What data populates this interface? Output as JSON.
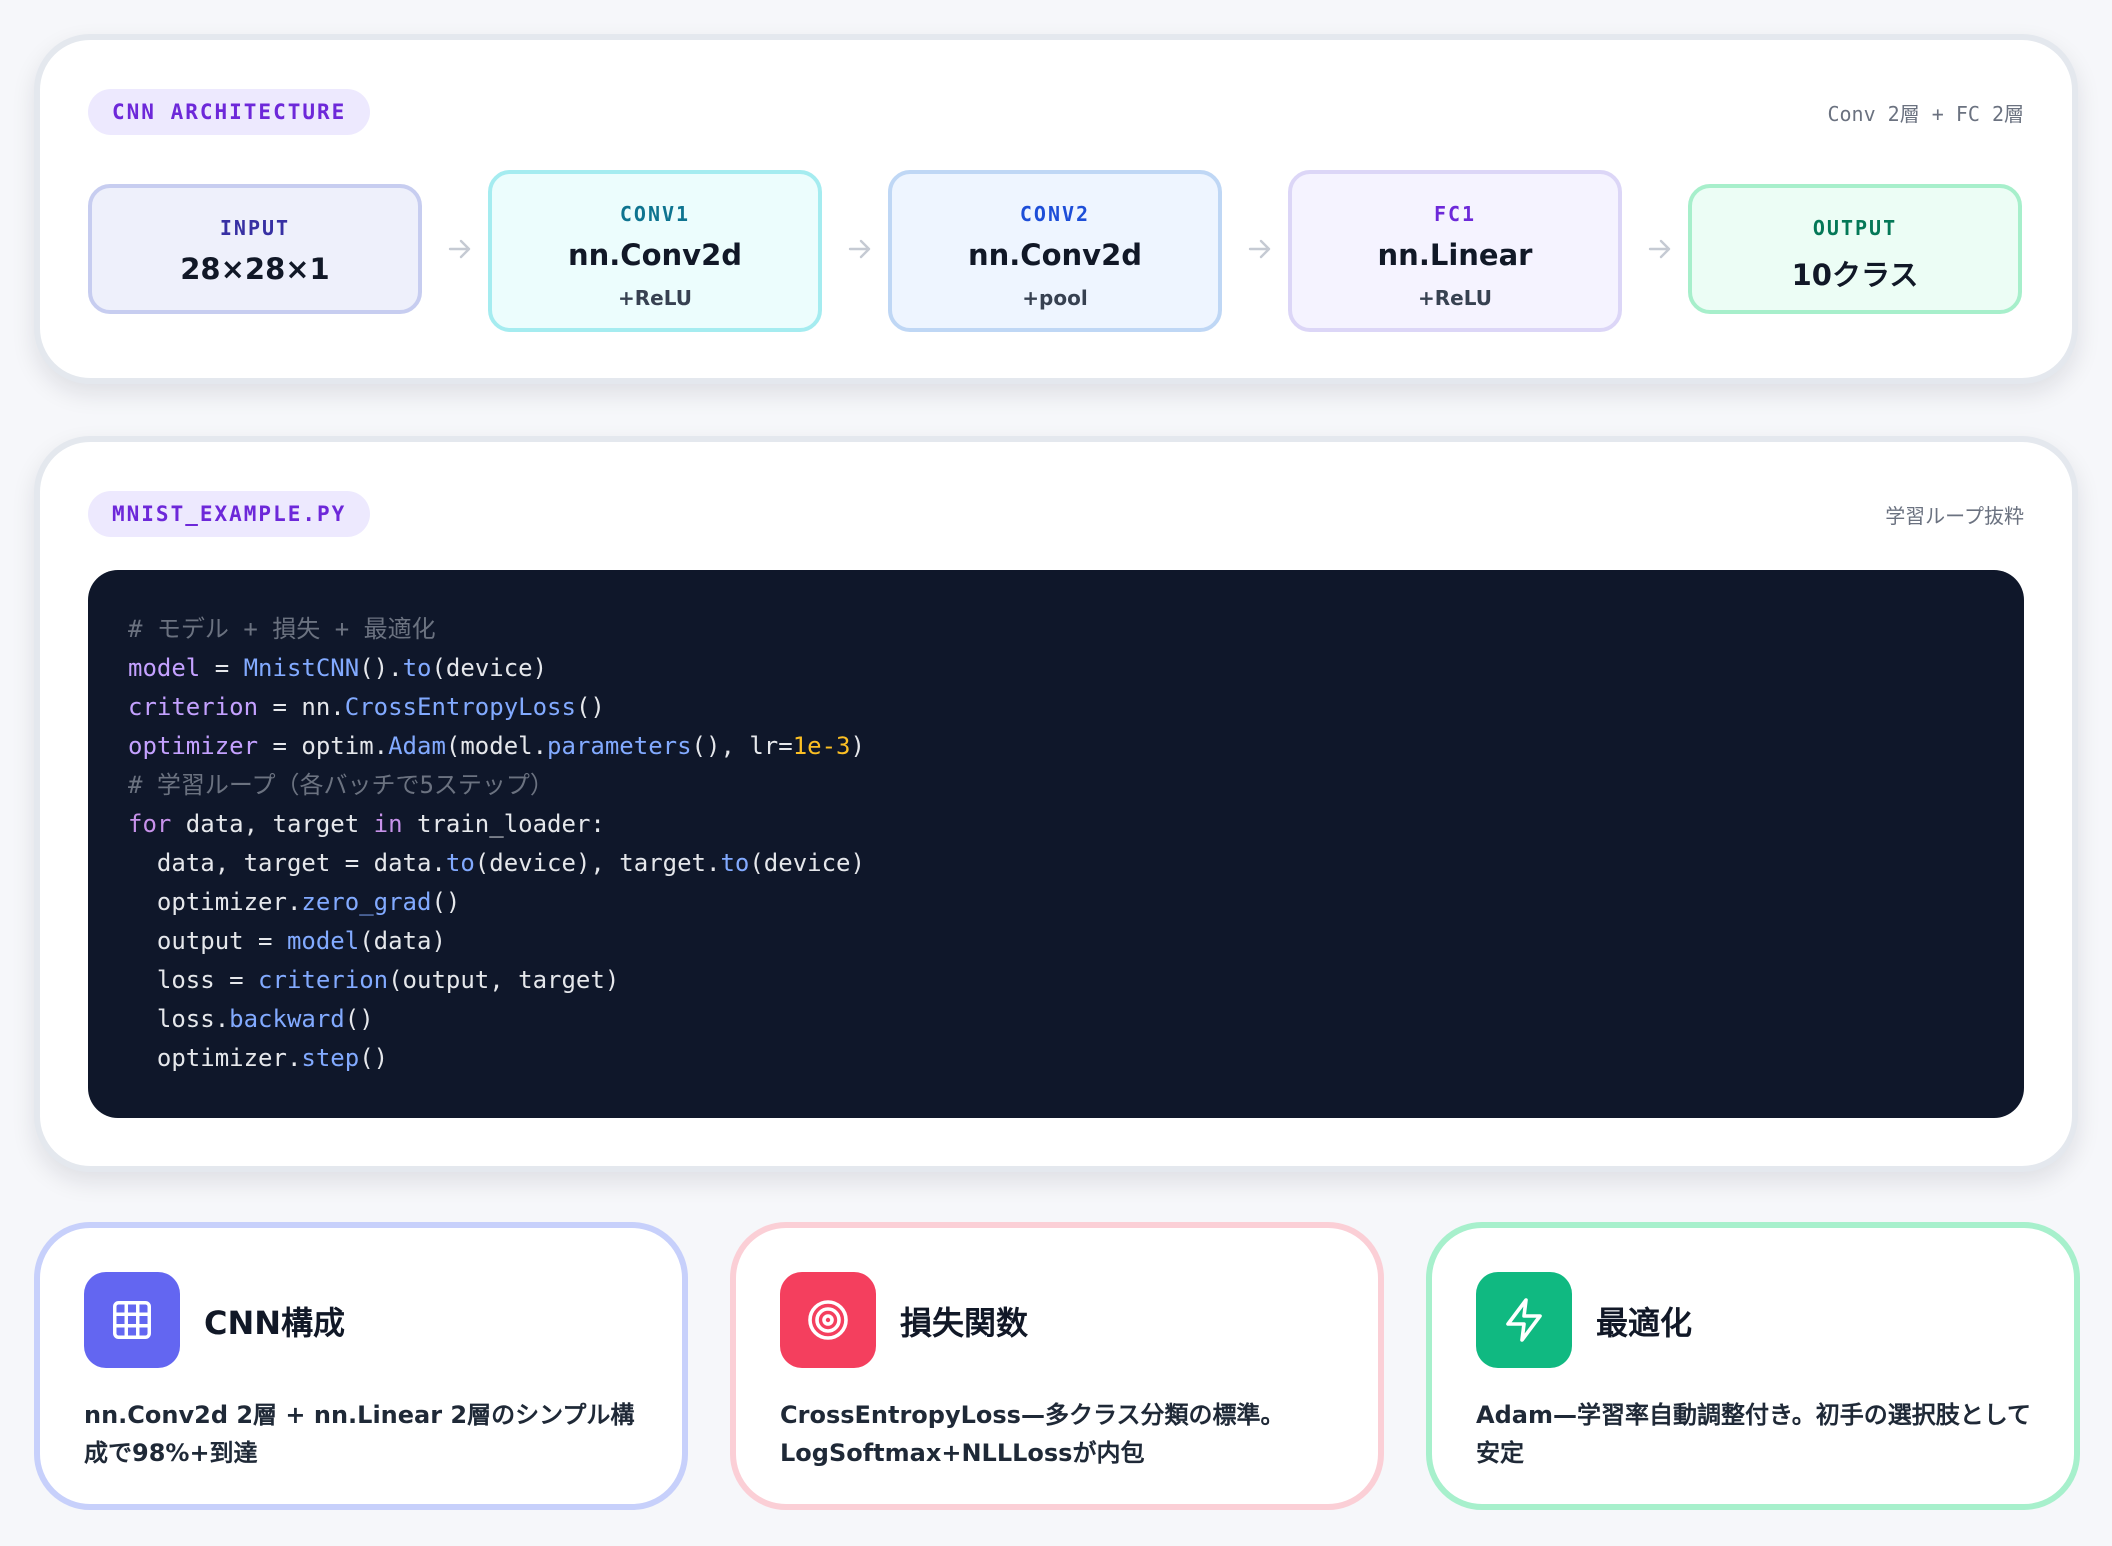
{
  "architecture": {
    "badge": "CNN ARCHITECTURE",
    "summary": "Conv 2層 + FC 2層",
    "stages": [
      {
        "label": "INPUT",
        "main": "28×28×1",
        "sub": ""
      },
      {
        "label": "CONV1",
        "main": "nn.Conv2d",
        "sub": "+ReLU"
      },
      {
        "label": "CONV2",
        "main": "nn.Conv2d",
        "sub": "+pool"
      },
      {
        "label": "FC1",
        "main": "nn.Linear",
        "sub": "+ReLU"
      },
      {
        "label": "OUTPUT",
        "main": "10クラス",
        "sub": ""
      }
    ]
  },
  "code": {
    "badge": "MNIST_EXAMPLE.PY",
    "caption": "学習ループ抜粋",
    "lines": [
      "# モデル + 損失 + 最適化",
      "model = MnistCNN().to(device)",
      "criterion = nn.CrossEntropyLoss()",
      "optimizer = optim.Adam(model.parameters(), lr=1e-3)",
      "# 学習ループ（各バッチで5ステップ）",
      "for data, target in train_loader:",
      "  data, target = data.to(device), target.to(device)",
      "  optimizer.zero_grad()",
      "  output = model(data)",
      "  loss = criterion(output, target)",
      "  loss.backward()",
      "  optimizer.step()"
    ]
  },
  "features": [
    {
      "icon": "grid-icon",
      "title": "CNN構成",
      "desc": "nn.Conv2d 2層 + nn.Linear 2層のシンプル構成で98%+到達"
    },
    {
      "icon": "target-icon",
      "title": "損失関数",
      "desc": "CrossEntropyLoss—多クラス分類の標準。LogSoftmax+NLLLossが内包"
    },
    {
      "icon": "lightning-icon",
      "title": "最適化",
      "desc": "Adam—学習率自動調整付き。初手の選択肢として安定"
    }
  ],
  "colors": {
    "accent_purple": "#6d28d9",
    "code_bg": "#0f172a",
    "cnn_icon": "#6366f1",
    "loss_icon": "#f43f5e",
    "opt_icon": "#10b981"
  }
}
